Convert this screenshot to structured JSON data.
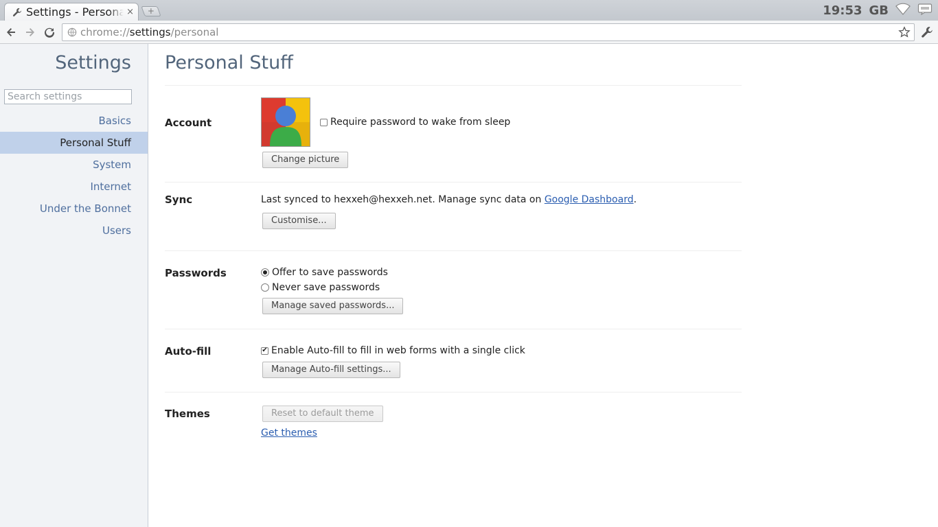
{
  "browser": {
    "tab": {
      "title": "Settings - Personal Stuff",
      "close": "×",
      "icon": "wrench-icon"
    },
    "new_tab": "+",
    "tray": {
      "clock": "19:53",
      "keyboard": "GB",
      "wifi_icon": "wifi-icon",
      "notification_icon": "notification-icon"
    },
    "omnibox": {
      "url_scheme": "chrome://",
      "url_host": "settings",
      "url_path": "/personal",
      "page_icon": "globe-icon",
      "star_icon": "star-icon"
    },
    "nav": {
      "back_icon": "back-arrow-icon",
      "forward_icon": "forward-arrow-icon",
      "reload_icon": "reload-icon",
      "menu_icon": "wrench-icon"
    }
  },
  "sidebar": {
    "title": "Settings",
    "search_placeholder": "Search settings",
    "items": [
      {
        "label": "Basics"
      },
      {
        "label": "Personal Stuff",
        "active": true
      },
      {
        "label": "System"
      },
      {
        "label": "Internet"
      },
      {
        "label": "Under the Bonnet"
      },
      {
        "label": "Users"
      }
    ]
  },
  "main": {
    "title": "Personal Stuff",
    "account": {
      "title": "Account",
      "require_password_label": "Require password to wake from sleep",
      "require_password_checked": false,
      "change_picture_label": "Change picture"
    },
    "sync": {
      "title": "Sync",
      "status_text": "Last synced to hexxeh@hexxeh.net. Manage sync data on",
      "dashboard_link": "Google Dashboard",
      "status_end": ".",
      "customise_label": "Customise..."
    },
    "passwords": {
      "title": "Passwords",
      "offer_label": "Offer to save passwords",
      "never_label": "Never save passwords",
      "selected": "offer",
      "manage_label": "Manage saved passwords..."
    },
    "autofill": {
      "title": "Auto-fill",
      "enable_label": "Enable Auto-fill to fill in web forms with a single click",
      "enable_checked": true,
      "manage_label": "Manage Auto-fill settings..."
    },
    "themes": {
      "title": "Themes",
      "reset_label": "Reset to default theme",
      "get_themes_link": "Get themes"
    }
  },
  "colors": {
    "accent_link": "#2a5db0",
    "sidebar_active": "#c0d1ea",
    "heading": "#52657b"
  }
}
